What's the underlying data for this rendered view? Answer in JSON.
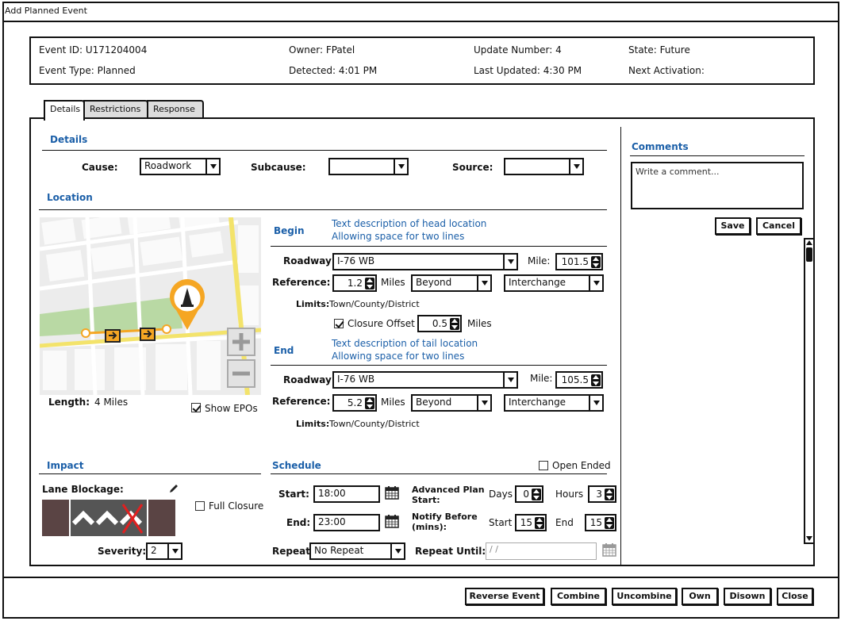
{
  "window": {
    "title": "Add Planned Event"
  },
  "header": {
    "event_id": "Event ID: U171204004",
    "event_type": "Event Type: Planned",
    "owner": "Owner: FPatel",
    "detected": "Detected: 4:01 PM",
    "update_number": "Update Number: 4",
    "last_updated": "Last Updated: 4:30 PM",
    "state": "State: Future",
    "next_activation": "Next Activation:"
  },
  "tabs": [
    {
      "label": "Details"
    },
    {
      "label": "Restrictions"
    },
    {
      "label": "Response"
    }
  ],
  "details": {
    "section_title": "Details",
    "cause_label": "Cause:",
    "cause_value": "Roadwork",
    "subcause_label": "Subcause:",
    "subcause_value": "",
    "source_label": "Source:",
    "source_value": ""
  },
  "location": {
    "section_title": "Location",
    "length_label": "Length:",
    "length_value": "4 Miles",
    "show_epos_label": "Show EPOs",
    "show_epos_checked": true,
    "begin": {
      "label": "Begin",
      "desc_line1": "Text description of head location",
      "desc_line2": "Allowing space for two lines",
      "roadway_label": "Roadway:",
      "roadway_value": "I-76 WB",
      "mile_label": "Mile:",
      "mile_value": "101.5",
      "reference_label": "Reference:",
      "reference_value": "1.2",
      "miles_label": "Miles",
      "direction_value": "Beyond",
      "ref_type_value": "Interchange",
      "limits_label": "Limits:",
      "limits_value": "Town/County/District",
      "closure_offset_label": "Closure Offset",
      "closure_offset_checked": true,
      "closure_offset_value": "0.5",
      "closure_offset_unit": "Miles"
    },
    "end": {
      "label": "End",
      "desc_line1": "Text description of tail location",
      "desc_line2": "Allowing space for two lines",
      "roadway_label": "Roadway:",
      "roadway_value": "I-76 WB",
      "mile_label": "Mile:",
      "mile_value": "105.5",
      "reference_label": "Reference:",
      "reference_value": "5.2",
      "miles_label": "Miles",
      "direction_value": "Beyond",
      "ref_type_value": "Interchange",
      "limits_label": "Limits:",
      "limits_value": "Town/County/District"
    }
  },
  "comments": {
    "section_title": "Comments",
    "placeholder": "Write a comment...",
    "save_label": "Save",
    "cancel_label": "Cancel"
  },
  "impact": {
    "section_title": "Impact",
    "lane_blockage_label": "Lane Blockage:",
    "full_closure_label": "Full Closure",
    "full_closure_checked": false,
    "severity_label": "Severity:",
    "severity_value": "2"
  },
  "schedule": {
    "section_title": "Schedule",
    "open_ended_label": "Open Ended",
    "open_ended_checked": false,
    "start_label": "Start:",
    "start_value": "18:00",
    "end_label": "End:",
    "end_value": "23:00",
    "advanced_plan_label_1": "Advanced Plan",
    "advanced_plan_label_2": "Start:",
    "days_label": "Days",
    "days_value": "0",
    "hours_label": "Hours",
    "hours_value": "3",
    "notify_label_1": "Notify Before",
    "notify_label_2": "(mins):",
    "notify_start_label": "Start",
    "notify_start_value": "15",
    "notify_end_label": "End",
    "notify_end_value": "15",
    "repeat_label": "Repeat:",
    "repeat_value": "No Repeat",
    "repeat_until_label": "Repeat Until:",
    "repeat_until_value": "/ /"
  },
  "footer": {
    "reverse_event": "Reverse Event",
    "combine": "Combine",
    "uncombine": "Uncombine",
    "own": "Own",
    "disown": "Disown",
    "close": "Close"
  },
  "colors": {
    "accent": "#1b5fa8",
    "map_park": "#b9d9a4",
    "map_road_major": "#f3e36b",
    "marker": "#f5a623",
    "lane_bg": "#5a4444",
    "lane_cell": "#555555"
  }
}
